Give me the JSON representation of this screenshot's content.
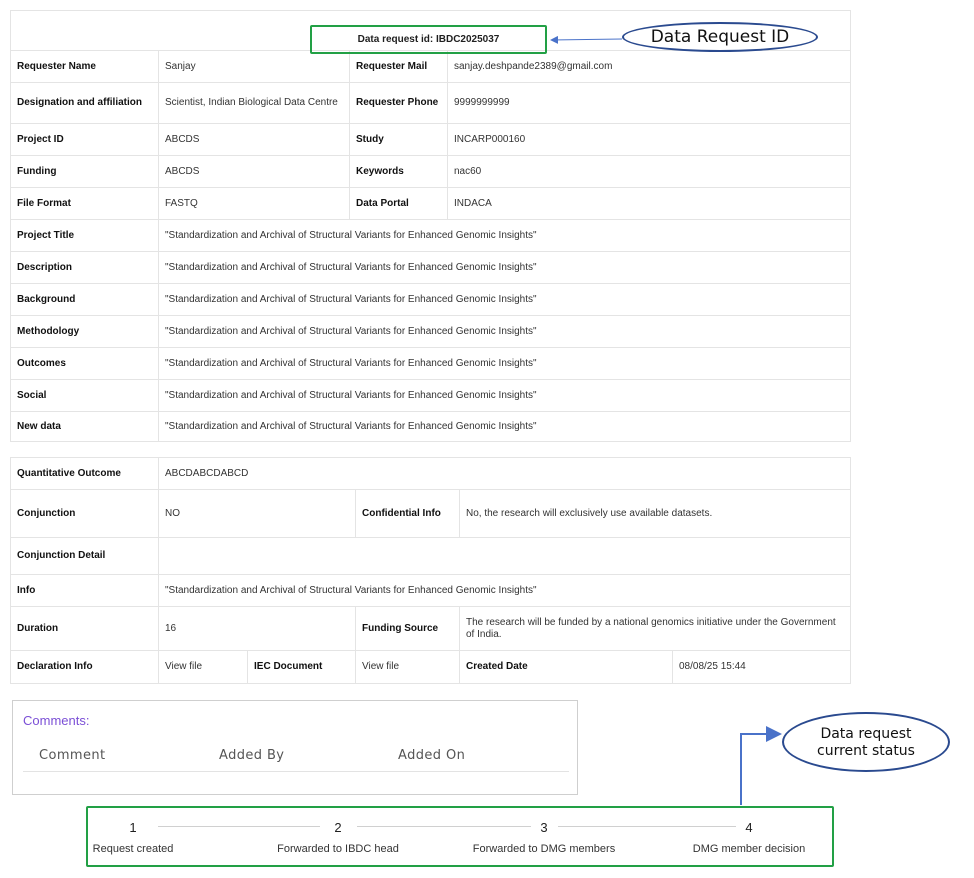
{
  "header": {
    "request_id_text": "Data request id: IBDC2025037"
  },
  "annotations": {
    "request_id_callout": "Data Request ID",
    "status_callout_line1": "Data request",
    "status_callout_line2": "current status"
  },
  "details": {
    "requester_name": {
      "label": "Requester Name",
      "value": "Sanjay"
    },
    "requester_mail": {
      "label": "Requester Mail",
      "value": "sanjay.deshpande2389@gmail.com"
    },
    "designation": {
      "label": "Designation and affiliation",
      "value": "Scientist, Indian Biological Data Centre"
    },
    "requester_phone": {
      "label": "Requester Phone",
      "value": "9999999999"
    },
    "project_id": {
      "label": "Project ID",
      "value": "ABCDS"
    },
    "study": {
      "label": "Study",
      "value": "INCARP000160"
    },
    "funding": {
      "label": "Funding",
      "value": "ABCDS"
    },
    "keywords": {
      "label": "Keywords",
      "value": "nac60"
    },
    "file_format": {
      "label": "File Format",
      "value": "FASTQ"
    },
    "data_portal": {
      "label": "Data Portal",
      "value": "INDACA"
    },
    "project_title": {
      "label": "Project Title",
      "value": "\"Standardization and Archival of Structural Variants for Enhanced Genomic Insights\""
    },
    "description": {
      "label": "Description",
      "value": "\"Standardization and Archival of Structural Variants for Enhanced Genomic Insights\""
    },
    "background": {
      "label": "Background",
      "value": "\"Standardization and Archival of Structural Variants for Enhanced Genomic Insights\""
    },
    "methodology": {
      "label": "Methodology",
      "value": "\"Standardization and Archival of Structural Variants for Enhanced Genomic Insights\""
    },
    "outcomes": {
      "label": "Outcomes",
      "value": "\"Standardization and Archival of Structural Variants for Enhanced Genomic Insights\""
    },
    "social": {
      "label": "Social",
      "value": "\"Standardization and Archival of Structural Variants for Enhanced Genomic Insights\""
    },
    "new_data": {
      "label": "New data",
      "value": "\"Standardization and Archival of Structural Variants for Enhanced Genomic Insights\""
    }
  },
  "details2": {
    "quantitative_outcome": {
      "label": "Quantitative Outcome",
      "value": "ABCDABCDABCD"
    },
    "conjunction": {
      "label": "Conjunction",
      "value": "NO"
    },
    "confidential_info": {
      "label": "Confidential Info",
      "value": "No, the research will exclusively use available datasets."
    },
    "conjunction_detail": {
      "label": "Conjunction Detail",
      "value": ""
    },
    "info": {
      "label": "Info",
      "value": "\"Standardization and Archival of Structural Variants for Enhanced Genomic Insights\""
    },
    "duration": {
      "label": "Duration",
      "value": "16"
    },
    "funding_source": {
      "label": "Funding Source",
      "value": "The research will be funded by a national genomics initiative under the Government of India."
    },
    "declaration_info": {
      "label": "Declaration Info",
      "link": "View file"
    },
    "iec_document": {
      "label": "IEC Document",
      "link": "View file"
    },
    "created_date": {
      "label": "Created Date",
      "value": "08/08/25 15:44"
    }
  },
  "comments": {
    "title": "Comments:",
    "columns": [
      "Comment",
      "Added By",
      "Added On"
    ]
  },
  "stepper": {
    "steps": [
      {
        "number": "1",
        "label": "Request created",
        "status": "done"
      },
      {
        "number": "2",
        "label": "Forwarded to IBDC head",
        "status": "done"
      },
      {
        "number": "3",
        "label": "Forwarded to DMG members",
        "status": "pending"
      },
      {
        "number": "4",
        "label": "DMG member decision",
        "status": "pending"
      }
    ]
  },
  "colors": {
    "accent_green": "#22a045",
    "step_done": "#1b7a31",
    "callout_blue": "#2a4a8f",
    "link": "#5b7fd9",
    "comments_title": "#7b4fd6"
  }
}
